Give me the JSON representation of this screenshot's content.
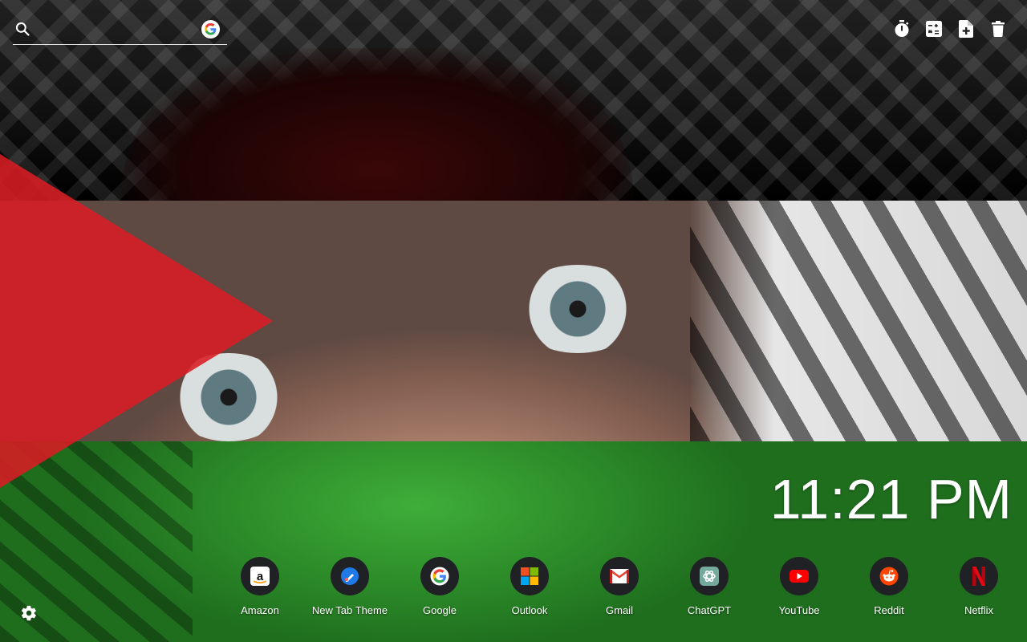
{
  "search": {
    "value": "",
    "placeholder": "",
    "engine_icon": "google-logo"
  },
  "toolbar": {
    "items": [
      {
        "icon": "stopwatch-icon"
      },
      {
        "icon": "calculator-icon"
      },
      {
        "icon": "add-note-icon"
      },
      {
        "icon": "trash-icon"
      }
    ]
  },
  "clock": {
    "time": "11:21 PM"
  },
  "shortcuts": [
    {
      "label": "Amazon",
      "icon": "amazon-icon"
    },
    {
      "label": "New Tab Theme",
      "icon": "new-tab-theme-icon"
    },
    {
      "label": "Google",
      "icon": "google-icon"
    },
    {
      "label": "Outlook",
      "icon": "microsoft-icon"
    },
    {
      "label": "Gmail",
      "icon": "gmail-icon"
    },
    {
      "label": "ChatGPT",
      "icon": "chatgpt-icon"
    },
    {
      "label": "YouTube",
      "icon": "youtube-icon"
    },
    {
      "label": "Reddit",
      "icon": "reddit-icon"
    },
    {
      "label": "Netflix",
      "icon": "netflix-icon"
    }
  ],
  "settings": {
    "icon": "gear-icon"
  },
  "colors": {
    "flag_red": "#da1c24",
    "flag_green": "#2e8f2a",
    "flag_black": "#000000",
    "shortcut_bg": "#202124"
  }
}
